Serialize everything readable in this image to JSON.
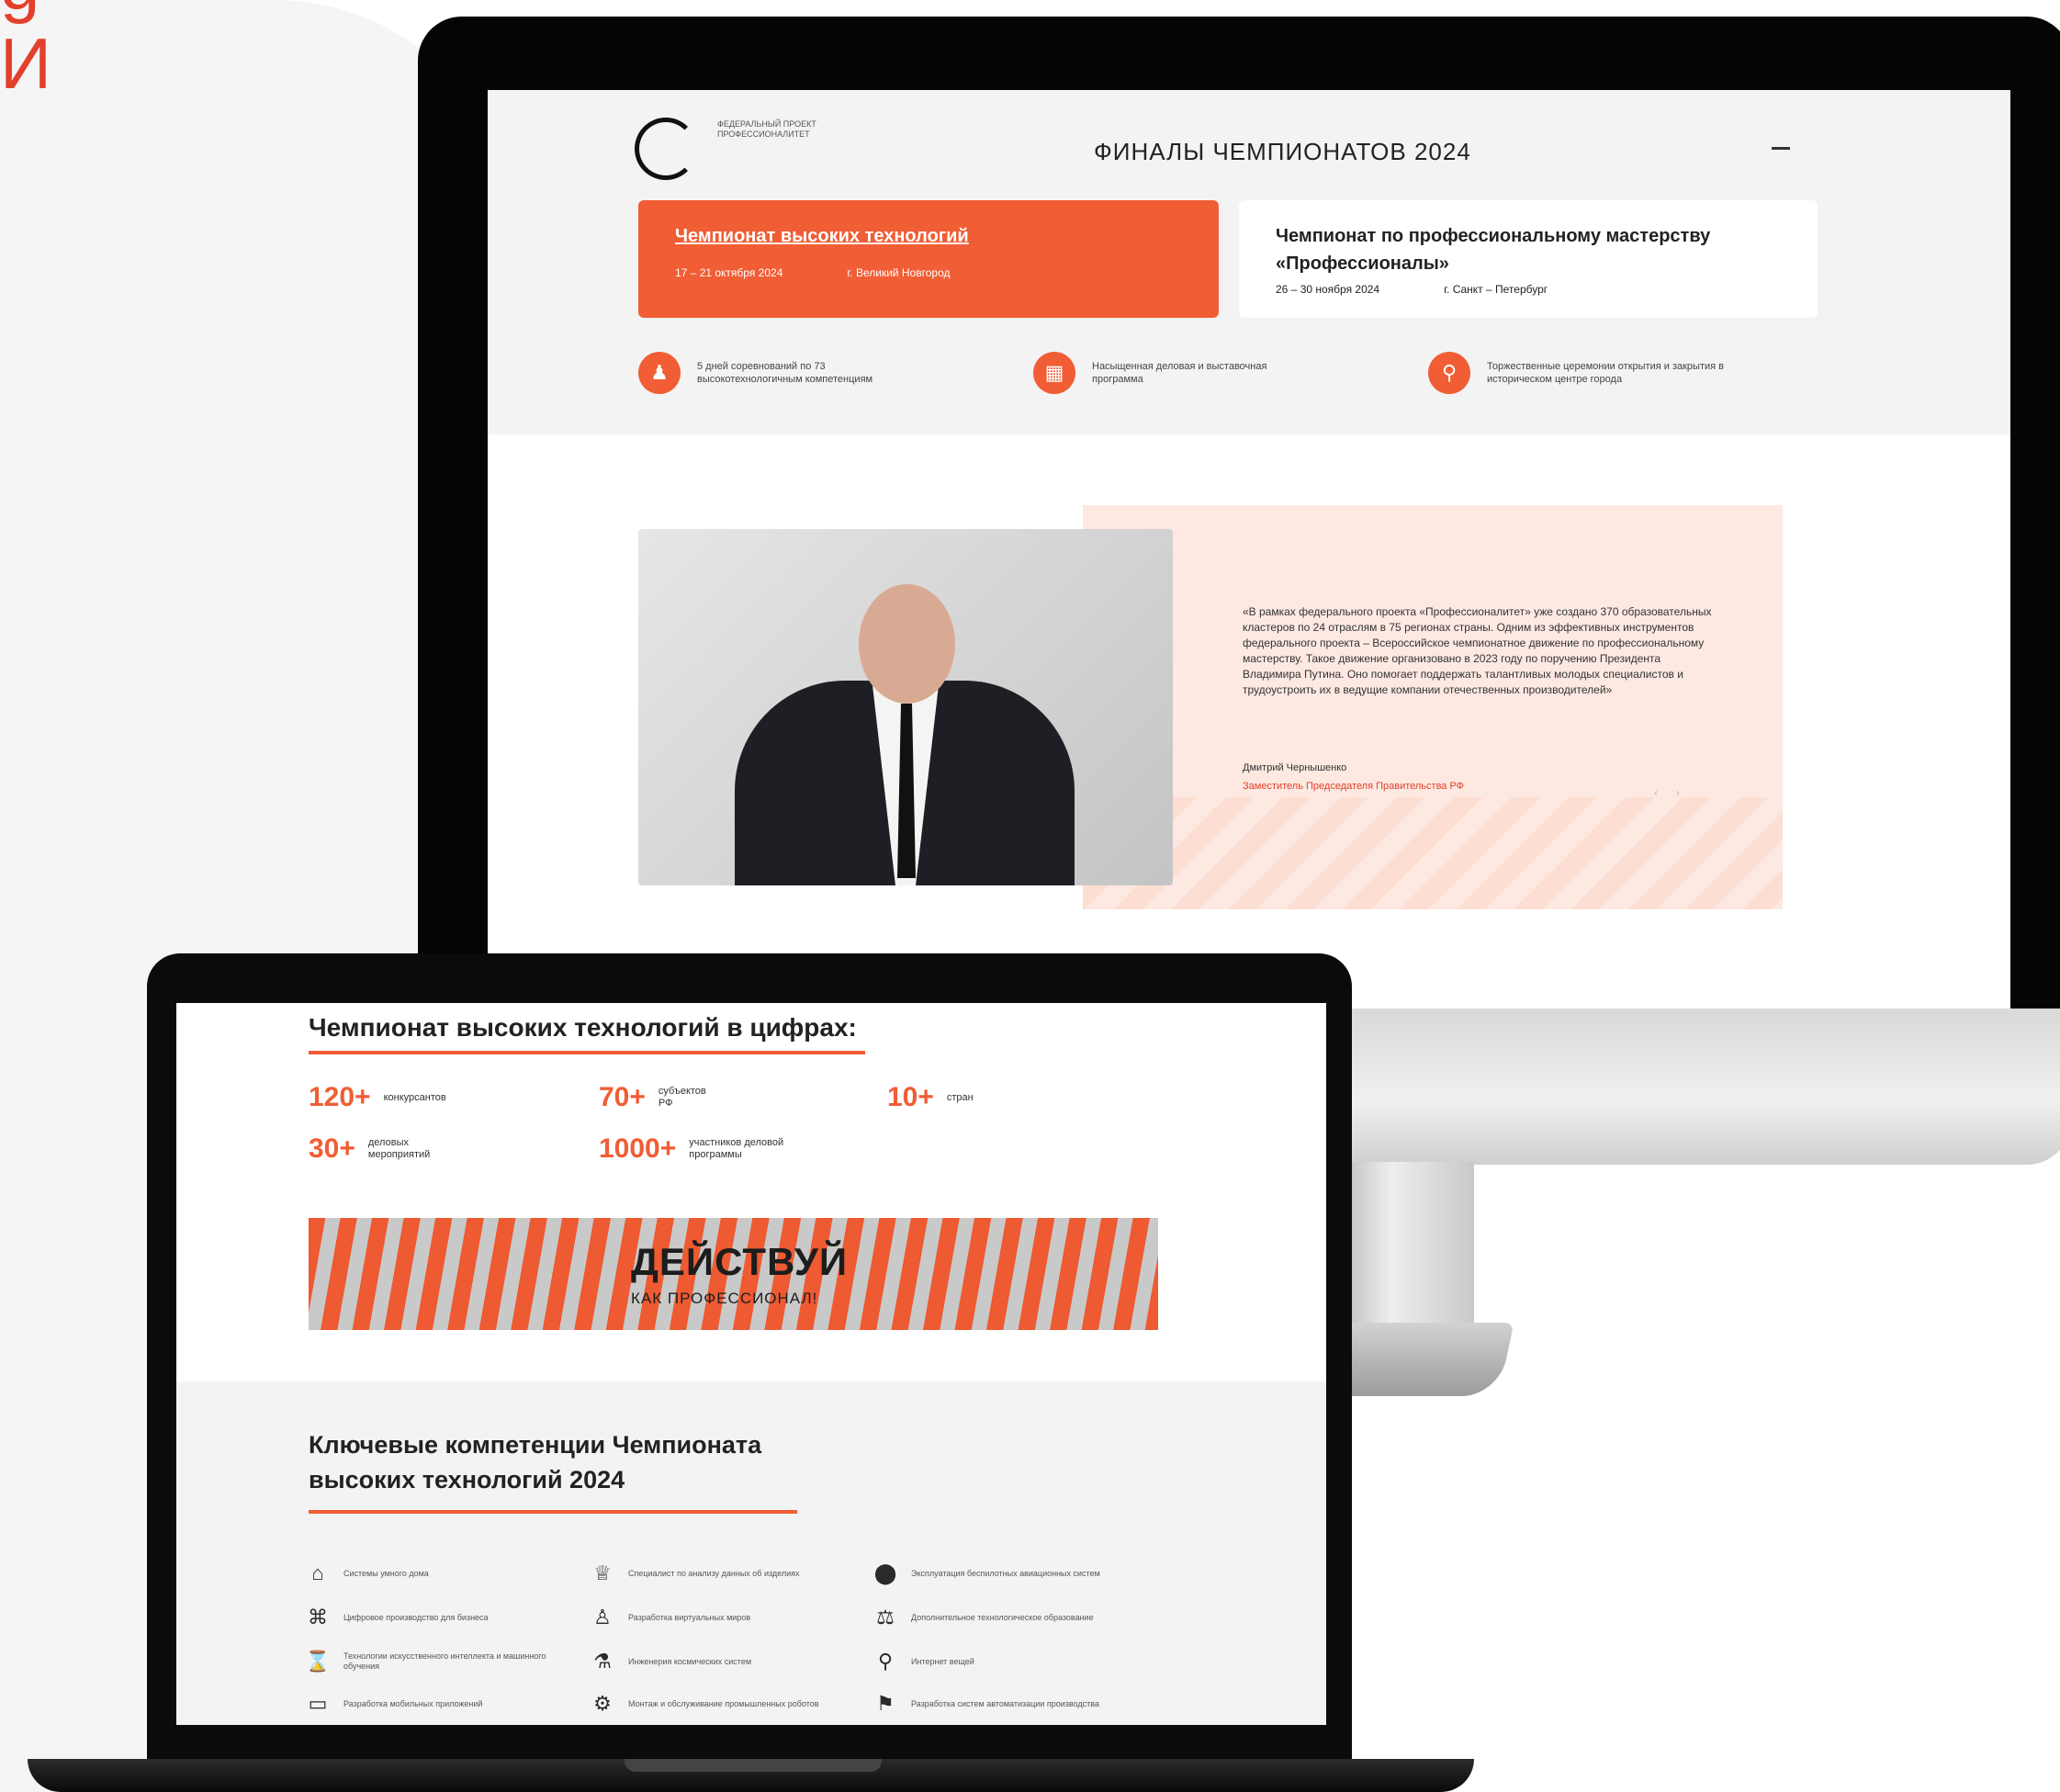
{
  "corner": {
    "lines": [
      "g",
      "И"
    ]
  },
  "monitor_site": {
    "logo_text": "ФЕДЕРАЛЬНЫЙ ПРОЕКТ ПРОФЕССИОНАЛИТЕТ",
    "title": "ФИНАЛЫ ЧЕМПИОНАТОВ 2024",
    "menu_icon": "minus",
    "cards": [
      {
        "title": "Чемпионат высоких технологий",
        "date": "17 – 21 октября 2024",
        "place": "г. Великий Новгород"
      },
      {
        "title": "Чемпионат по профессиональному мастерству «Профессионалы»",
        "date": "26 – 30 ноября 2024",
        "place": "г. Санкт – Петербург"
      }
    ],
    "features": [
      {
        "icon": "person-icon",
        "text": "5 дней соревнований по 73 высокотехнологичным компетенциям"
      },
      {
        "icon": "calendar-icon",
        "text": "Насыщенная деловая и выставочная программа"
      },
      {
        "icon": "location-icon",
        "text": "Торжественные церемонии открытия и закрытия в историческом центре города"
      }
    ],
    "quote": {
      "text": "«В рамках федерального проекта «Профессионалитет» уже создано 370 образовательных кластеров по 24 отраслям в 75 регионах страны. Одним из эффективных инструментов федерального проекта – Всероссийское чемпионатное движение по профессиональному мастерству. Такое движение организовано в 2023 году по поручению Президента Владимира Путина. Оно помогает поддержать талантливых молодых специалистов и трудоустроить их в ведущие компании отечественных производителей»",
      "author": "Дмитрий Чернышенко",
      "role": "Заместитель Председателя Правительства РФ",
      "nav": [
        "‹",
        "›"
      ]
    }
  },
  "laptop_site": {
    "stats_title": "Чемпионат высоких технологий в цифрах:",
    "stats": [
      {
        "value": "120+",
        "label": "конкурсантов"
      },
      {
        "value": "70+",
        "label": "субъектов РФ"
      },
      {
        "value": "10+",
        "label": "стран"
      },
      {
        "value": "30+",
        "label": "деловых мероприятий"
      },
      {
        "value": "1000+",
        "label": "участников деловой программы"
      }
    ],
    "banner": {
      "main": "ДЕЙСТВУЙ",
      "sub": "КАК ПРОФЕССИОНАЛ!"
    },
    "competencies_title_line1": "Ключевые компетенции Чемпионата",
    "competencies_title_line2": "высоких технологий 2024",
    "competencies": [
      {
        "icon": "⌂",
        "text": "Системы умного дома"
      },
      {
        "icon": "♕",
        "text": "Специалист по анализу данных об изделиях"
      },
      {
        "icon": "⬤",
        "text": "Эксплуатация беспилотных авиационных систем"
      },
      {
        "icon": "⌘",
        "text": "Цифровое производство для бизнеса"
      },
      {
        "icon": "♙",
        "text": "Разработка виртуальных миров"
      },
      {
        "icon": "⚖",
        "text": "Дополнительное технологическое образование"
      },
      {
        "icon": "⌛",
        "text": "Технологии искусственного интеллекта и машинного обучения"
      },
      {
        "icon": "⚗",
        "text": "Инженерия космических систем"
      },
      {
        "icon": "⚲",
        "text": "Интернет вещей"
      },
      {
        "icon": "▭",
        "text": "Разработка мобильных приложений"
      },
      {
        "icon": "⚙",
        "text": "Монтаж и обслуживание промышленных роботов"
      },
      {
        "icon": "⚑",
        "text": "Разработка систем автоматизации производства"
      }
    ]
  }
}
